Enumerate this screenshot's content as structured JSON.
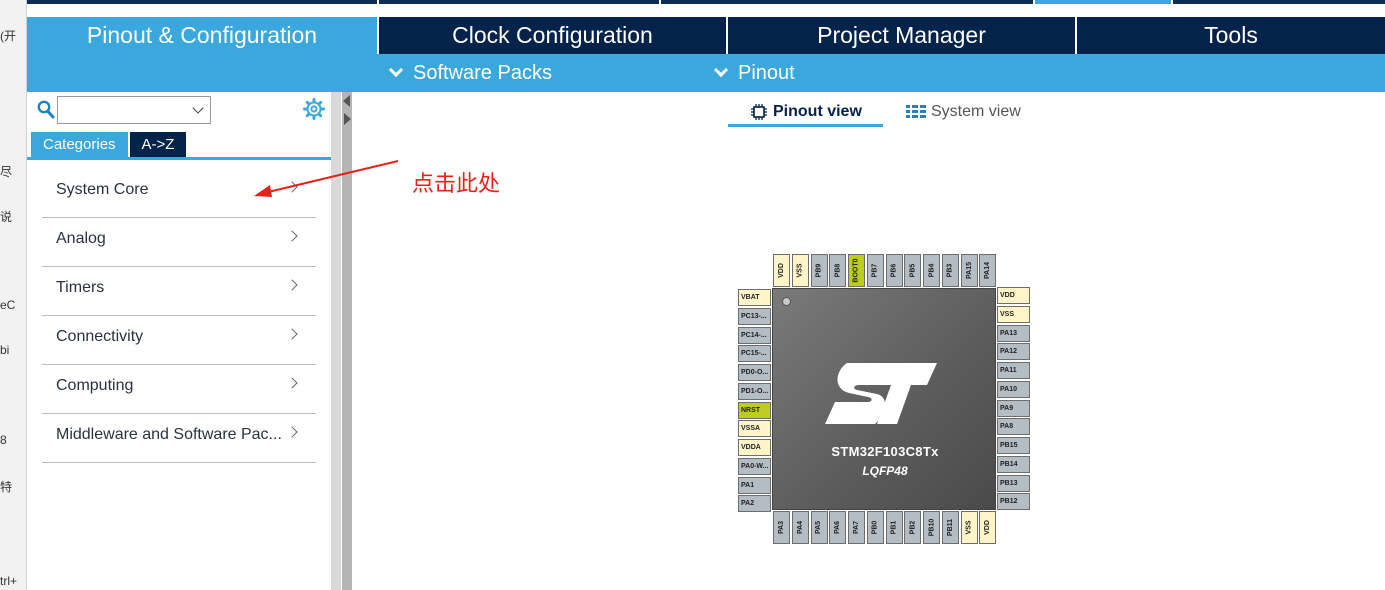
{
  "left_fragments": [
    "(开",
    "尽",
    "说",
    "eC",
    "bi",
    "8",
    "特",
    "trl+"
  ],
  "top_tabs": [
    {
      "label": "Pinout & Configuration",
      "active": true
    },
    {
      "label": "Clock Configuration",
      "active": false
    },
    {
      "label": "Project Manager",
      "active": false
    },
    {
      "label": "Tools",
      "active": false
    }
  ],
  "submenus": [
    {
      "label": "Software Packs"
    },
    {
      "label": "Pinout"
    }
  ],
  "search": {
    "value": ""
  },
  "category_tabs": [
    {
      "label": "Categories",
      "active": true
    },
    {
      "label": "A->Z",
      "active": false
    }
  ],
  "categories": [
    {
      "label": "System Core"
    },
    {
      "label": "Analog"
    },
    {
      "label": "Timers"
    },
    {
      "label": "Connectivity"
    },
    {
      "label": "Computing"
    },
    {
      "label": "Middleware and Software Pac..."
    }
  ],
  "view_tabs": [
    {
      "label": "Pinout view",
      "active": true,
      "icon": "chip-icon"
    },
    {
      "label": "System view",
      "active": false,
      "icon": "grid-icon"
    }
  ],
  "annotation": {
    "text": "点击此处",
    "color": "#e8221b"
  },
  "chip": {
    "name": "STM32F103C8Tx",
    "package": "LQFP48",
    "top_pins": [
      {
        "label": "VDD",
        "type": "power"
      },
      {
        "label": "VSS",
        "type": "power"
      },
      {
        "label": "PB9",
        "type": "gray"
      },
      {
        "label": "PB8",
        "type": "gray"
      },
      {
        "label": "BOOT0",
        "type": "green"
      },
      {
        "label": "PB7",
        "type": "gray"
      },
      {
        "label": "PB6",
        "type": "gray"
      },
      {
        "label": "PB5",
        "type": "gray"
      },
      {
        "label": "PB4",
        "type": "gray"
      },
      {
        "label": "PB3",
        "type": "gray"
      },
      {
        "label": "PA15",
        "type": "gray"
      },
      {
        "label": "PA14",
        "type": "gray"
      }
    ],
    "left_pins": [
      {
        "label": "VBAT",
        "type": "power"
      },
      {
        "label": "PC13-...",
        "type": "gray"
      },
      {
        "label": "PC14-...",
        "type": "gray"
      },
      {
        "label": "PC15-...",
        "type": "gray"
      },
      {
        "label": "PD0-O...",
        "type": "gray"
      },
      {
        "label": "PD1-O...",
        "type": "gray"
      },
      {
        "label": "NRST",
        "type": "green"
      },
      {
        "label": "VSSA",
        "type": "power"
      },
      {
        "label": "VDDA",
        "type": "power"
      },
      {
        "label": "PA0-W...",
        "type": "gray"
      },
      {
        "label": "PA1",
        "type": "gray"
      },
      {
        "label": "PA2",
        "type": "gray"
      }
    ],
    "right_pins": [
      {
        "label": "VDD",
        "type": "power"
      },
      {
        "label": "VSS",
        "type": "power"
      },
      {
        "label": "PA13",
        "type": "gray"
      },
      {
        "label": "PA12",
        "type": "gray"
      },
      {
        "label": "PA11",
        "type": "gray"
      },
      {
        "label": "PA10",
        "type": "gray"
      },
      {
        "label": "PA9",
        "type": "gray"
      },
      {
        "label": "PA8",
        "type": "gray"
      },
      {
        "label": "PB15",
        "type": "gray"
      },
      {
        "label": "PB14",
        "type": "gray"
      },
      {
        "label": "PB13",
        "type": "gray"
      },
      {
        "label": "PB12",
        "type": "gray"
      }
    ],
    "bottom_pins": [
      {
        "label": "PA3",
        "type": "gray"
      },
      {
        "label": "PA4",
        "type": "gray"
      },
      {
        "label": "PA5",
        "type": "gray"
      },
      {
        "label": "PA6",
        "type": "gray"
      },
      {
        "label": "PA7",
        "type": "gray"
      },
      {
        "label": "PB0",
        "type": "gray"
      },
      {
        "label": "PB1",
        "type": "gray"
      },
      {
        "label": "PB2",
        "type": "gray"
      },
      {
        "label": "PB10",
        "type": "gray"
      },
      {
        "label": "PB11",
        "type": "gray"
      },
      {
        "label": "VSS",
        "type": "power"
      },
      {
        "label": "VDD",
        "type": "power"
      }
    ]
  },
  "colors": {
    "navy": "#03234b",
    "accent": "#3aa8dc",
    "pin_gray": "#b4bcc4",
    "pin_power": "#fff5c8",
    "pin_green": "#bccd1e"
  }
}
